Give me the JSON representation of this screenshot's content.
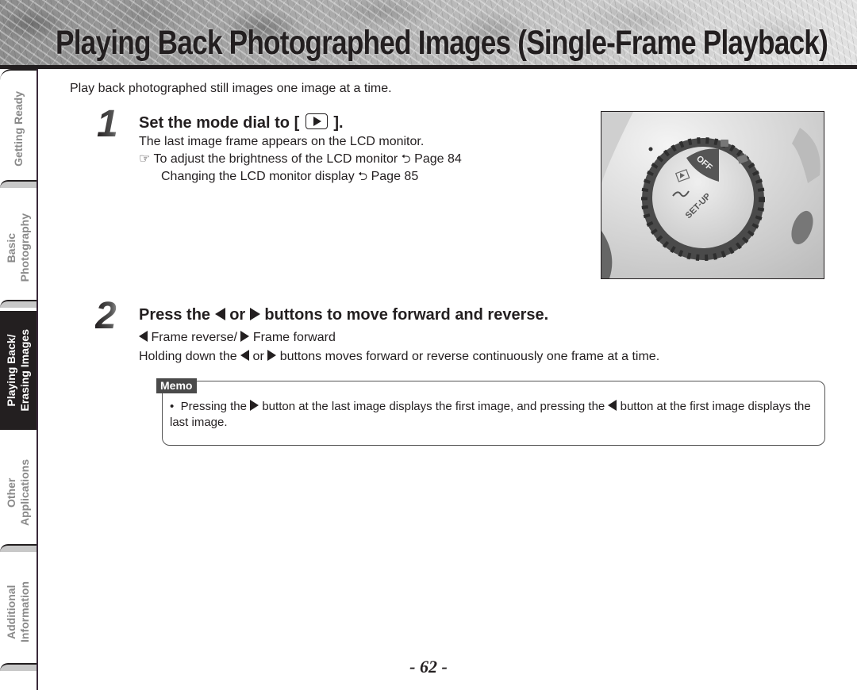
{
  "header": {
    "title": "Playing Back Photographed Images (Single-Frame Playback)"
  },
  "side_tabs": [
    {
      "line1": "",
      "line2": "Getting Ready",
      "active": false
    },
    {
      "line1": "Basic",
      "line2": "Photography",
      "active": false
    },
    {
      "line1": "Playing Back/",
      "line2": "Erasing Images",
      "active": true
    },
    {
      "line1": "Other",
      "line2": "Applications",
      "active": false
    },
    {
      "line1": "Additional",
      "line2": "Information",
      "active": false
    }
  ],
  "intro": "Play back photographed still images one image at a time.",
  "step1": {
    "number": "1",
    "title_before": "Set the mode dial to [",
    "title_icon": "play-icon",
    "title_after": "].",
    "line1": "The last image frame appears on the LCD monitor.",
    "ref_icon": "pointing-hand-icon",
    "ref1_text": "To adjust the brightness of the LCD monitor",
    "ref1_page": "Page 84",
    "ref2_text": "Changing the LCD monitor display",
    "ref2_page": "Page 85",
    "image": {
      "alt": "Camera mode dial photo",
      "dial_labels": [
        "OFF",
        "SET-UP"
      ]
    }
  },
  "step2": {
    "number": "2",
    "title_p1": "Press the",
    "title_p2": "or",
    "title_p3": "buttons to move forward and reverse.",
    "line1_a": "Frame reverse/",
    "line1_b": "Frame forward",
    "line2_a": "Holding down the",
    "line2_b": "or",
    "line2_c": "buttons moves forward or reverse continuously one frame at a time."
  },
  "memo": {
    "label": "Memo",
    "bullet": "•",
    "text_a": "Pressing the",
    "text_b": "button at the last image displays the first image, and pressing the",
    "text_c": "button at the first image displays the last image."
  },
  "page_number": "- 62 -"
}
